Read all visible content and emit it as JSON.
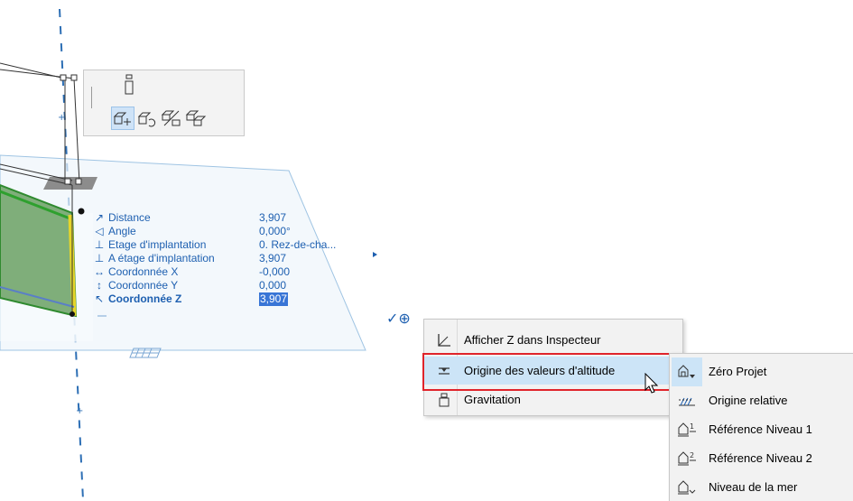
{
  "tracker": {
    "rows": [
      {
        "icon": "↗",
        "label": "Distance",
        "value": "3,907"
      },
      {
        "icon": "◁",
        "label": "Angle",
        "value": "0,000°"
      },
      {
        "icon": "⊥",
        "label": "Etage d'implantation",
        "value": "0. Rez-de-cha..."
      },
      {
        "icon": "⊥",
        "label": "A étage d'implantation",
        "value": "3,907"
      },
      {
        "icon": "↔",
        "label": "Coordonnée X",
        "value": "-0,000"
      },
      {
        "icon": "↕",
        "label": "Coordonnée Y",
        "value": "0,000"
      },
      {
        "icon": "↖",
        "label": "Coordonnée Z",
        "value": "3,907"
      }
    ],
    "confirm_glyphs": "✓⊕"
  },
  "context_menu": {
    "items": [
      {
        "label": "Afficher Z dans Inspecteur",
        "icon": "z-axis-icon"
      },
      {
        "label": "Origine des valeurs d'altitude",
        "icon": "elevation-origin-icon",
        "has_submenu": true,
        "highlighted": true
      },
      {
        "label": "Gravitation",
        "icon": "gravity-icon",
        "has_submenu": true
      }
    ]
  },
  "submenu": {
    "items": [
      {
        "label": "Zéro Projet",
        "icon": "project-zero-icon",
        "highlighted": true
      },
      {
        "label": "Origine relative",
        "icon": "relative-origin-icon"
      },
      {
        "label": "Référence Niveau 1",
        "icon": "reference-level-1-icon",
        "sup": "1"
      },
      {
        "label": "Référence Niveau 2",
        "icon": "reference-level-2-icon",
        "sup": "2"
      },
      {
        "label": "Niveau de la mer",
        "icon": "sea-level-icon"
      }
    ]
  },
  "colors": {
    "accent": "#1d5fb0",
    "selection": "#3875d6",
    "menu_highlight": "#cce4f7",
    "highlight_frame": "#e0242b",
    "wall_green": "#7fae7a"
  }
}
